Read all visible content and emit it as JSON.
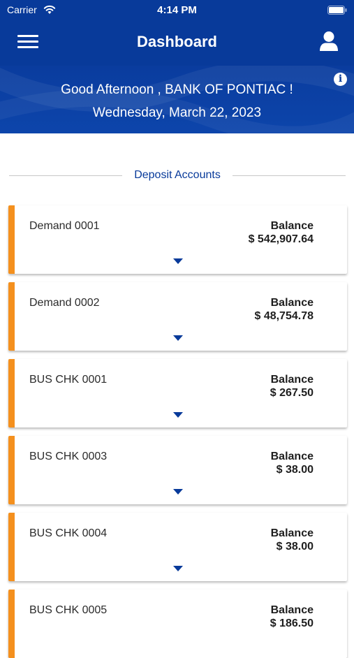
{
  "status_bar": {
    "carrier": "Carrier",
    "time": "4:14 PM"
  },
  "nav": {
    "title": "Dashboard"
  },
  "banner": {
    "greeting": "Good Afternoon , BANK OF PONTIAC !",
    "date": "Wednesday, March 22, 2023"
  },
  "section": {
    "title": "Deposit Accounts"
  },
  "accounts": [
    {
      "name": "Demand 0001",
      "balance_label": "Balance",
      "balance": "$ 542,907.64"
    },
    {
      "name": "Demand 0002",
      "balance_label": "Balance",
      "balance": "$ 48,754.78"
    },
    {
      "name": "BUS CHK 0001",
      "balance_label": "Balance",
      "balance": "$ 267.50"
    },
    {
      "name": "BUS CHK 0003",
      "balance_label": "Balance",
      "balance": "$ 38.00"
    },
    {
      "name": "BUS CHK 0004",
      "balance_label": "Balance",
      "balance": "$ 38.00"
    },
    {
      "name": "BUS CHK 0005",
      "balance_label": "Balance",
      "balance": "$ 186.50"
    }
  ],
  "icons": {
    "menu": "hamburger-menu-icon",
    "profile": "user-icon",
    "info": "info-icon",
    "expand": "chevron-down-icon",
    "wifi": "wifi-icon",
    "battery": "battery-icon"
  },
  "colors": {
    "primary": "#083a9a",
    "accent": "#f4901e",
    "background": "#ffffff"
  }
}
